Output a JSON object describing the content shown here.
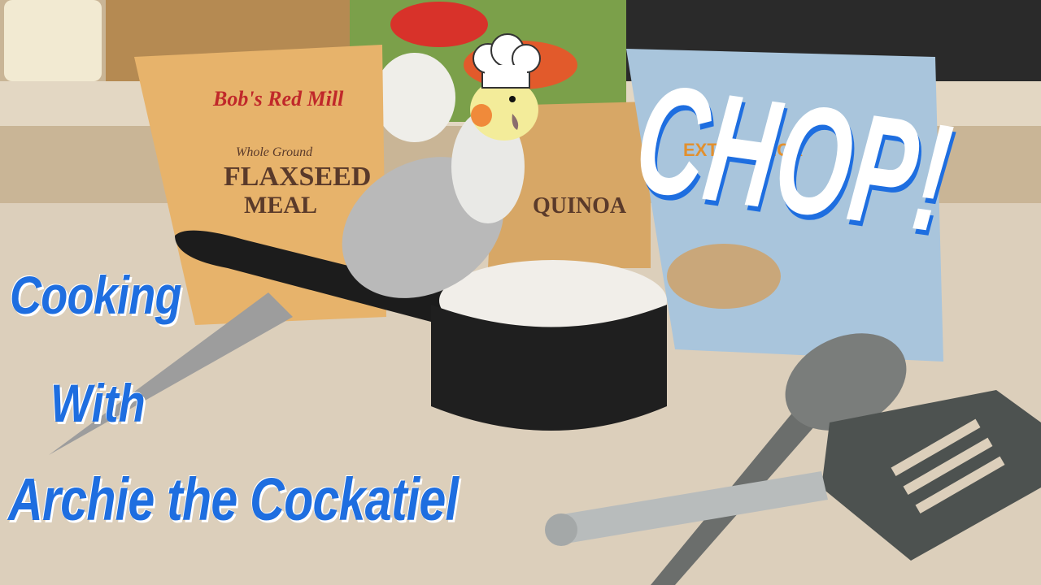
{
  "overlay": {
    "line1": "Cooking",
    "line2": "With",
    "line3": "Archie the Cockatiel",
    "exclaim": "CHOP!"
  },
  "packages": {
    "flax_brand": "Bob's Red Mill",
    "flax_sub": "Whole Ground",
    "flax_name": "FLAXSEED",
    "flax_name2": "MEAL",
    "quinoa_name": "QUINOA",
    "oats_label": "EXTRA THICK"
  },
  "colors": {
    "text_blue": "#1e6ee0",
    "text_white": "#ffffff",
    "counter": "#d9cbb6"
  }
}
